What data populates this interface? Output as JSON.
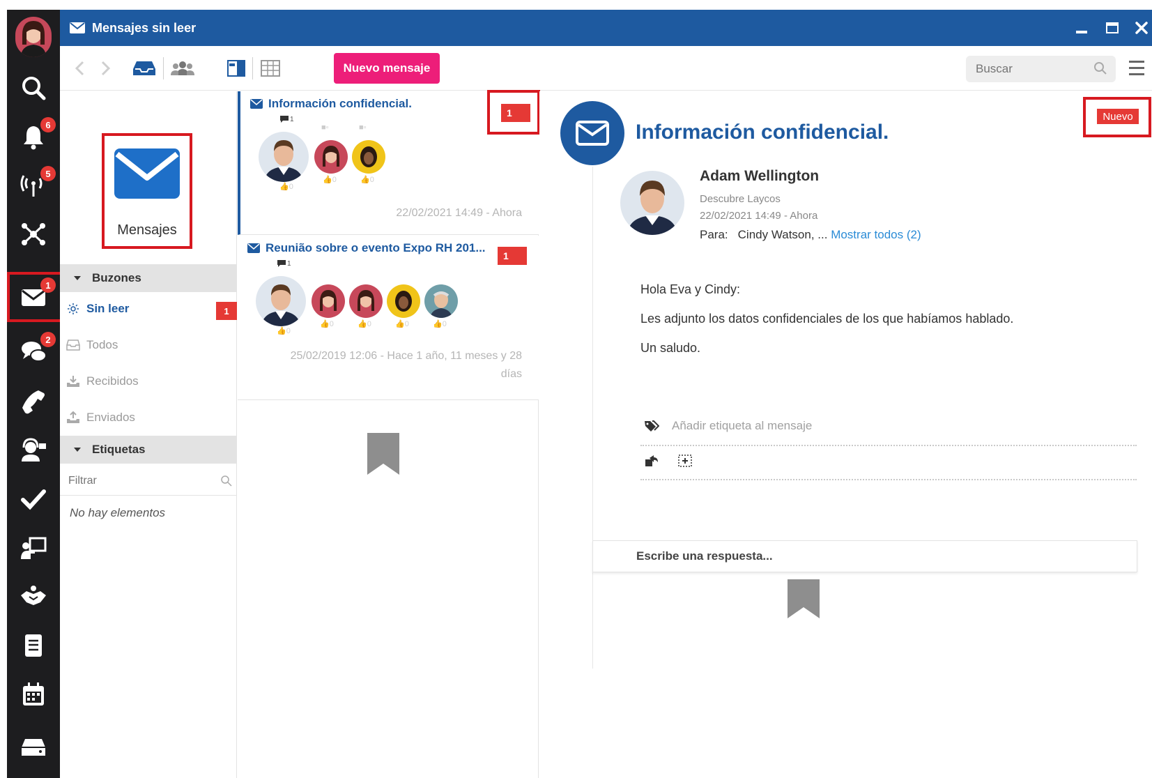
{
  "window": {
    "title": "Mensajes sin leer",
    "accent_color": "#1e5aa0",
    "nav_color": "#1d1d1f",
    "badge_color": "#e53935",
    "primary_button_color": "#ed1e79"
  },
  "left_nav": {
    "items": [
      {
        "name": "search-icon",
        "badge": ""
      },
      {
        "name": "bell-icon",
        "badge": "6"
      },
      {
        "name": "broadcast-icon",
        "badge": "5"
      },
      {
        "name": "network-icon",
        "badge": ""
      },
      {
        "name": "envelope-icon",
        "badge": "1"
      },
      {
        "name": "chat-icon",
        "badge": "2"
      },
      {
        "name": "phone-icon",
        "badge": ""
      },
      {
        "name": "support-agent-icon",
        "badge": ""
      },
      {
        "name": "checkmark-icon",
        "badge": ""
      },
      {
        "name": "presentation-icon",
        "badge": ""
      },
      {
        "name": "handshake-icon",
        "badge": ""
      },
      {
        "name": "document-icon",
        "badge": ""
      },
      {
        "name": "calendar-icon",
        "badge": ""
      },
      {
        "name": "inbox-drive-icon",
        "badge": ""
      }
    ]
  },
  "toolbar": {
    "new_message_label": "Nuevo mensaje",
    "search_placeholder": "Buscar"
  },
  "folders": {
    "hero_label": "Mensajes",
    "mailboxes_header": "Buzones",
    "items": [
      {
        "label": "Sin leer",
        "badge": "1",
        "active": true,
        "icon": "sun-icon"
      },
      {
        "label": "Todos",
        "badge": "",
        "active": false,
        "icon": "inbox-icon"
      },
      {
        "label": "Recibidos",
        "badge": "",
        "active": false,
        "icon": "download-tray-icon"
      },
      {
        "label": "Enviados",
        "badge": "",
        "active": false,
        "icon": "upload-tray-icon"
      }
    ],
    "labels_header": "Etiquetas",
    "filter_placeholder": "Filtrar",
    "empty_text": "No hay elementos"
  },
  "messages": [
    {
      "subject": "Información confidencial.",
      "badge": "1",
      "comment_count": "1",
      "date": "22/02/2021 14:49 - Ahora"
    },
    {
      "subject": "Reunião sobre o evento Expo RH 201...",
      "badge": "1",
      "comment_count": "1",
      "date_line1": "25/02/2019 12:06 - Hace 1 año, 11 meses y 28",
      "date_line2": "días"
    }
  ],
  "detail": {
    "title": "Información confidencial.",
    "status_tag": "Nuevo",
    "sender_name": "Adam Wellington",
    "sender_org": "Descubre Laycos",
    "sender_date": "22/02/2021 14:49 - Ahora",
    "to_label": "Para:",
    "to_value": "Cindy Watson, ...",
    "show_all": "Mostrar todos (2)",
    "body": [
      "Hola Eva y Cindy:",
      "Les adjunto los datos confidenciales de los que habíamos hablado.",
      "Un saludo."
    ],
    "add_tag_text": "Añadir etiqueta al mensaje",
    "reply_placeholder": "Escribe una respuesta..."
  }
}
